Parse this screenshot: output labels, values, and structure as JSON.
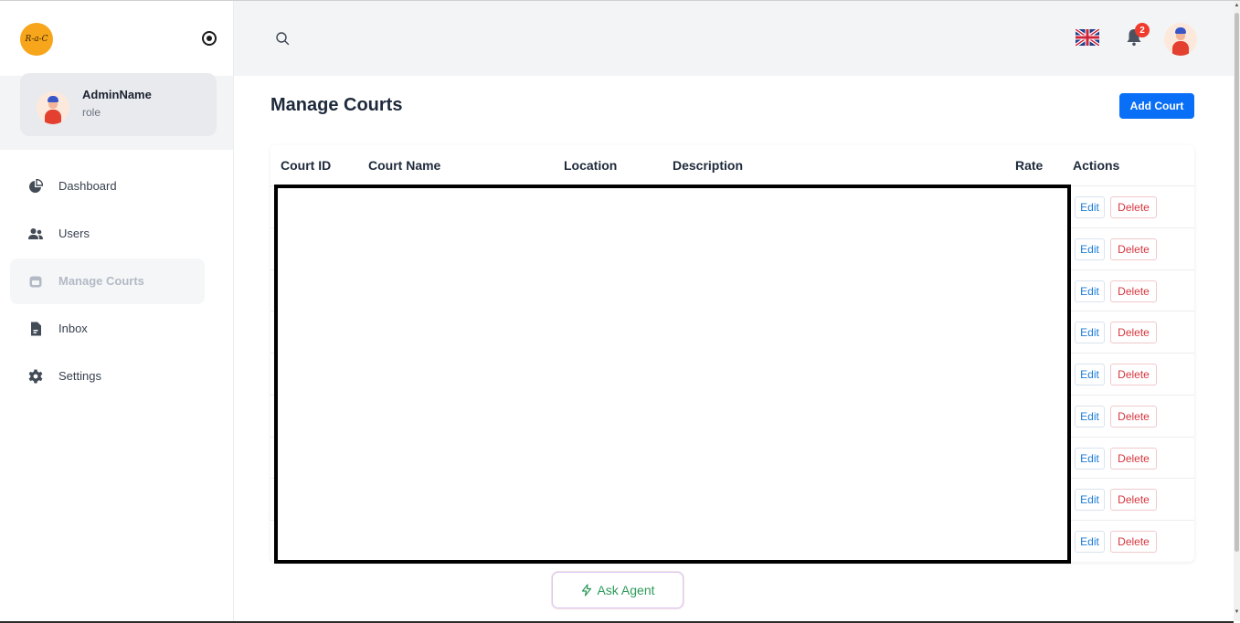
{
  "logo": {
    "text": "R-a-C"
  },
  "profile": {
    "name": "AdminName",
    "role": "role"
  },
  "nav": [
    {
      "label": "Dashboard",
      "icon": "pie-chart-icon"
    },
    {
      "label": "Users",
      "icon": "users-icon"
    },
    {
      "label": "Manage Courts",
      "icon": "calendar-icon",
      "active": true
    },
    {
      "label": "Inbox",
      "icon": "document-icon"
    },
    {
      "label": "Settings",
      "icon": "gear-icon"
    }
  ],
  "header": {
    "notification_count": "2",
    "language": "English (UK)"
  },
  "page": {
    "title": "Manage Courts",
    "add_button": "Add Court"
  },
  "table": {
    "columns": [
      "Court ID",
      "Court Name",
      "Location",
      "Description",
      "Rate",
      "Actions"
    ],
    "rows": [
      {
        "edit": "Edit",
        "delete": "Delete"
      },
      {
        "edit": "Edit",
        "delete": "Delete"
      },
      {
        "edit": "Edit",
        "delete": "Delete"
      },
      {
        "edit": "Edit",
        "delete": "Delete"
      },
      {
        "edit": "Edit",
        "delete": "Delete"
      },
      {
        "edit": "Edit",
        "delete": "Delete"
      },
      {
        "edit": "Edit",
        "delete": "Delete"
      },
      {
        "edit": "Edit",
        "delete": "Delete"
      },
      {
        "edit": "Edit",
        "delete": "Delete"
      }
    ]
  },
  "ask_agent": {
    "label": "Ask Agent"
  },
  "colors": {
    "primary": "#0a6ff7",
    "danger": "#d6363e",
    "accent_logo": "#f7a51b"
  }
}
